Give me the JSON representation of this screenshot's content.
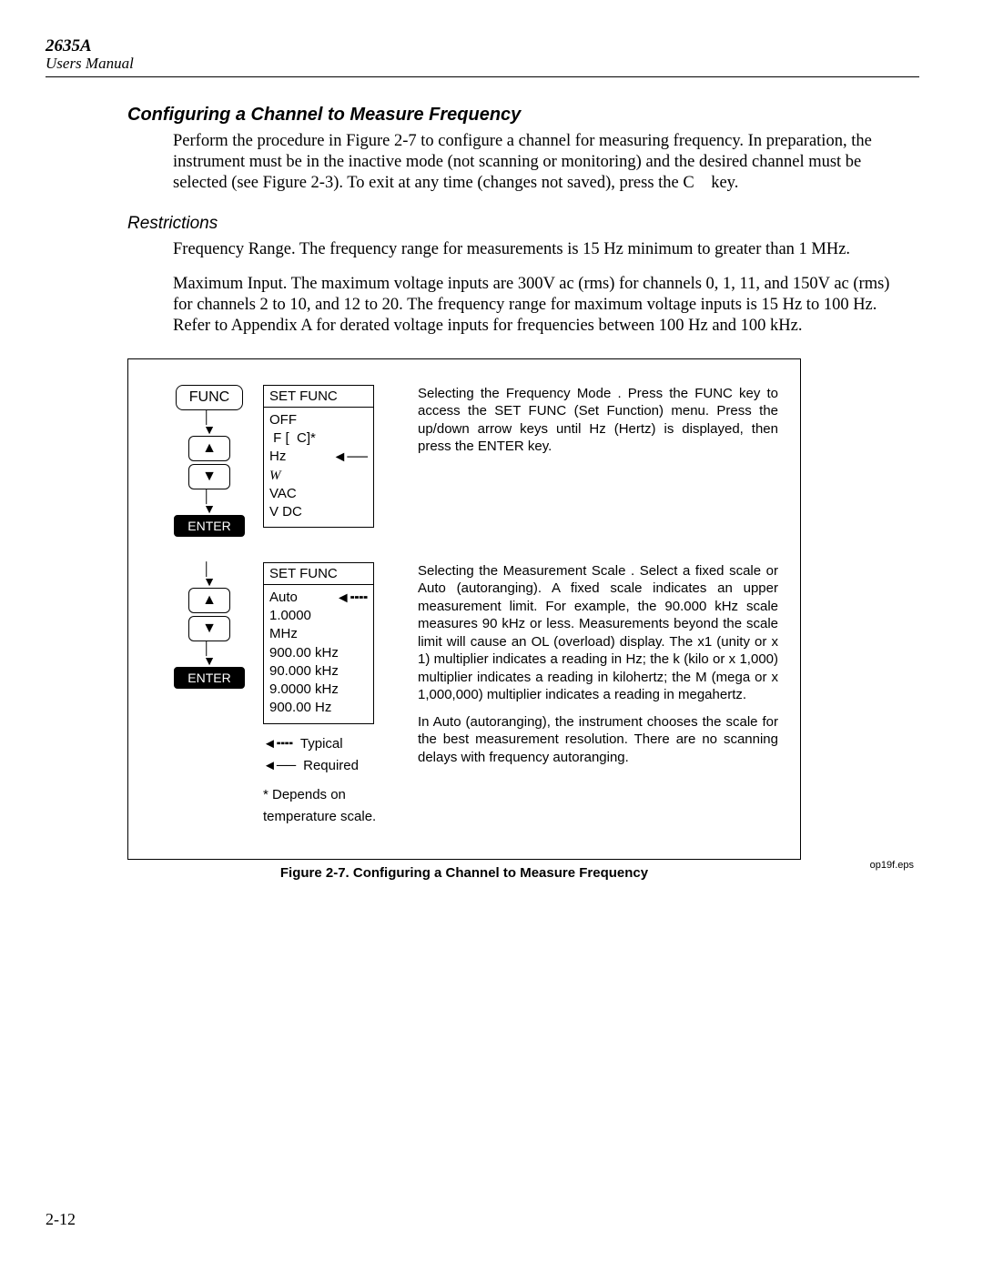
{
  "header": {
    "model": "2635A",
    "subtitle": "Users Manual"
  },
  "section1": {
    "title": "Configuring a Channel to Measure Frequency",
    "body": "Perform the procedure in Figure 2-7 to configure a channel for measuring frequency. In preparation, the instrument must be in the inactive mode (not scanning or monitoring) and the desired channel must be selected (see Figure 2-3). To exit at any time (changes not saved), press the C    key."
  },
  "section2": {
    "title": "Restrictions",
    "p1": "Frequency Range. The frequency range for measurements is 15 Hz minimum to greater than 1 MHz.",
    "p2": "Maximum Input. The maximum voltage inputs are 300V ac (rms) for channels 0, 1, 11, and 150V ac (rms) for channels 2 to 10, and 12 to 20. The frequency range for maximum voltage inputs is 15 Hz to 100 Hz. Refer to Appendix A for derated voltage inputs for frequencies between 100 Hz and 100 kHz."
  },
  "flow": {
    "func": "FUNC",
    "enter": "ENTER",
    "menu1_header": "SET FUNC",
    "menu1_items": [
      "OFF",
      " F [  C]*",
      "Hz",
      "W",
      "VAC",
      "V DC"
    ],
    "menu2_header": "SET FUNC",
    "menu2_items": [
      "Auto",
      "1.0000 MHz",
      "900.00 kHz",
      "90.000 kHz",
      "9.0000 kHz",
      "900.00 Hz"
    ],
    "legend_typical": "Typical",
    "legend_required": "Required",
    "legend_note": "*  Depends on temperature scale."
  },
  "desc": {
    "step1": "Selecting the Frequency Mode .  Press the FUNC key to access the SET FUNC (Set Function) menu.  Press the up/down arrow keys until Hz (Hertz) is displayed, then press the ENTER key.",
    "step2a": "Selecting the Measurement Scale .  Select a fixed scale or Auto (autoranging).  A fixed scale indicates an upper measurement limit.  For example, the 90.000 kHz scale measures 90 kHz or less.  Measurements beyond the scale limit will cause an OL (overload) display.  The x1 (unity or x 1) multiplier indicates a reading in Hz; the k (kilo or x 1,000) multiplier indicates a reading in kilohertz; the M (mega or x 1,000,000) multiplier indicates a reading in megahertz.",
    "step2b": "In Auto (autoranging), the instrument chooses the scale for the best measurement resolution.  There are no scanning delays with frequency autoranging."
  },
  "figure": {
    "eps": "op19f.eps",
    "caption": "Figure 2-7. Configuring a Channel to Measure Frequency"
  },
  "pagenum": "2-12"
}
